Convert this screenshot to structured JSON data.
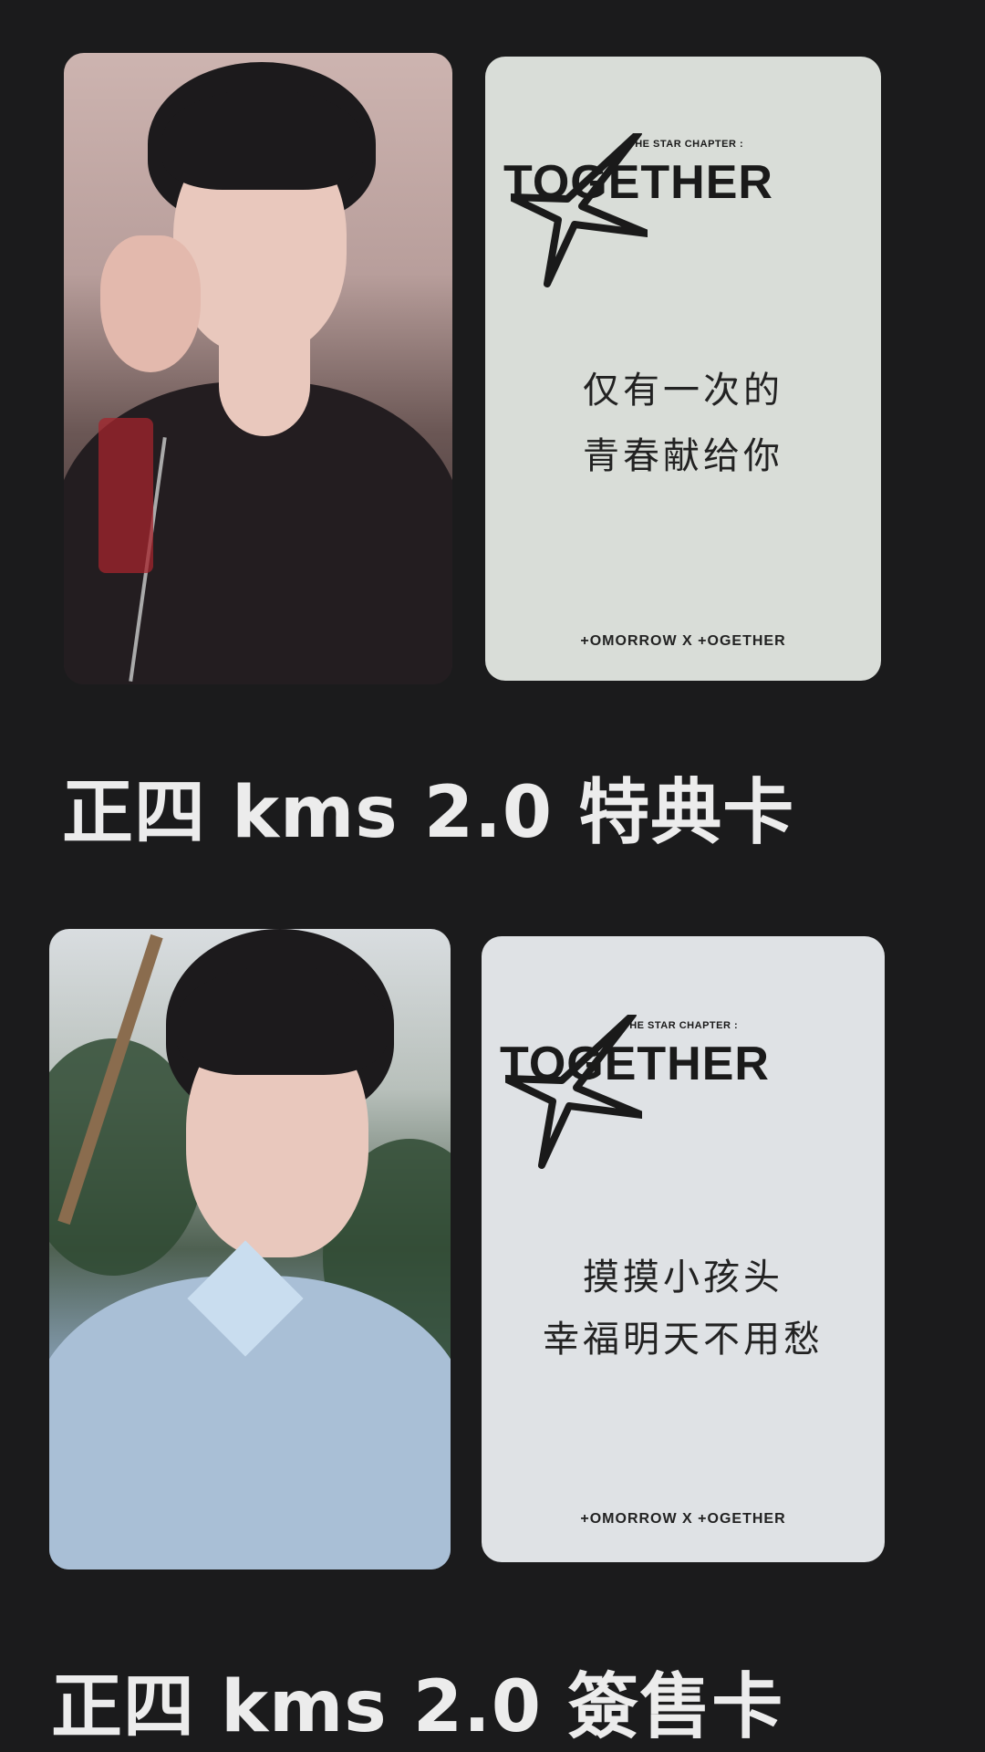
{
  "sections": [
    {
      "caption": "正四 kms 2.0 特典卡",
      "card_back": {
        "logo_subtitle": "THE STAR CHAPTER :",
        "logo_word": "TOGETHER",
        "message_line1": "仅有一次的",
        "message_line2": "青春献给你",
        "footer": "+OMORROW X +OGETHER"
      }
    },
    {
      "caption": "正四 kms 2.0 簽售卡",
      "card_back": {
        "logo_subtitle": "THE STAR CHAPTER :",
        "logo_word": "TOGETHER",
        "message_line1": "摸摸小孩头",
        "message_line2": "幸福明天不用愁",
        "footer": "+OMORROW X +OGETHER"
      }
    }
  ],
  "colors": {
    "background": "#1b1b1c",
    "caption": "#ececec"
  }
}
